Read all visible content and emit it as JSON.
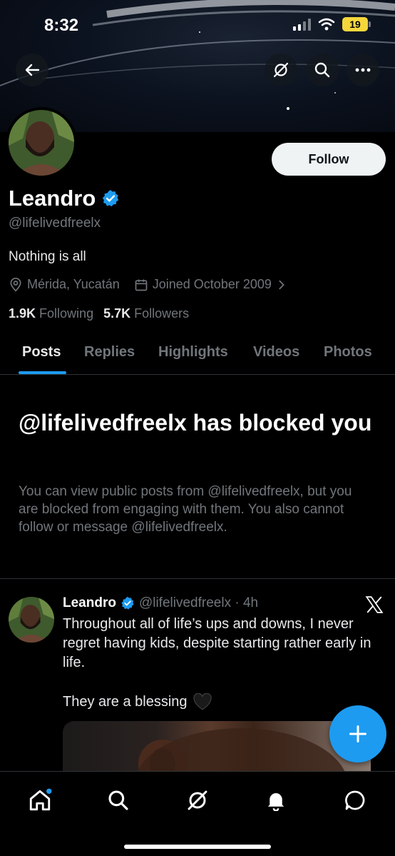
{
  "status_bar": {
    "time": "8:32",
    "battery": "19"
  },
  "profile": {
    "name": "Leandro",
    "handle": "@lifelivedfreelx",
    "bio": "Nothing is all",
    "location": "Mérida, Yucatán",
    "joined": "Joined October 2009",
    "following_count": "1.9K",
    "following_label": "Following",
    "followers_count": "5.7K",
    "followers_label": "Followers",
    "follow_label": "Follow"
  },
  "tabs": [
    {
      "label": "Posts",
      "active": true
    },
    {
      "label": "Replies"
    },
    {
      "label": "Highlights"
    },
    {
      "label": "Videos"
    },
    {
      "label": "Photos"
    }
  ],
  "blocked": {
    "title": "@lifelivedfreelx has blocked you",
    "text": "You can view public posts from @lifelivedfreelx, but you are blocked from engaging with them. You also cannot follow or message @lifelivedfreelx."
  },
  "tweet": {
    "name": "Leandro",
    "handle_time": "@lifelivedfreelx · 4h",
    "text": "Throughout all of life’s ups and downs, I never regret having kids, despite starting rather early in life.",
    "text2": "They are a blessing"
  },
  "colors": {
    "accent": "#1d9bf0",
    "background": "#000000",
    "muted": "#71767b"
  },
  "icons": [
    "back-arrow-icon",
    "grok-icon",
    "search-icon",
    "more-icon",
    "verified-icon",
    "location-icon",
    "calendar-icon",
    "chevron-right-icon",
    "x-logo-icon",
    "black-heart-icon",
    "compose-plus-icon",
    "home-icon",
    "notifications-icon",
    "messages-icon"
  ]
}
